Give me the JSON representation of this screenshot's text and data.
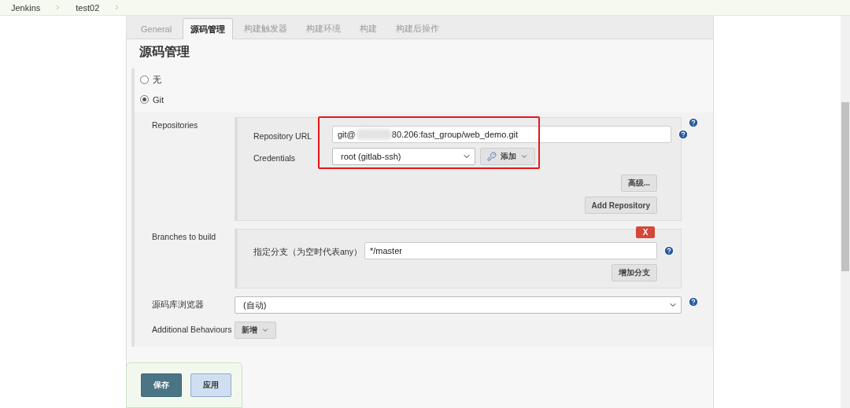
{
  "breadcrumbs": [
    "Jenkins",
    "test02"
  ],
  "tabs": [
    {
      "label": "General",
      "selected": false
    },
    {
      "label": "源码管理",
      "selected": true
    },
    {
      "label": "构建触发器",
      "selected": false
    },
    {
      "label": "构建环境",
      "selected": false
    },
    {
      "label": "构建",
      "selected": false
    },
    {
      "label": "构建后操作",
      "selected": false
    }
  ],
  "heading": "源码管理",
  "scm_options": [
    {
      "label": "无",
      "selected": false
    },
    {
      "label": "Git",
      "selected": true
    }
  ],
  "repositories": {
    "label": "Repositories",
    "url_label": "Repository URL",
    "url_prefix": "git@",
    "url_suffix": "80.206:fast_group/web_demo.git",
    "credentials_label": "Credentials",
    "credentials_value": "root (gitlab-ssh)",
    "add_button": "添加",
    "advanced_button": "高级...",
    "add_repository_button": "Add Repository"
  },
  "branches": {
    "label": "Branches to build",
    "delete_button": "X",
    "branch_label": "指定分支（为空时代表any）",
    "branch_value": "*/master",
    "add_branch_button": "增加分支"
  },
  "browser": {
    "label": "源码库浏览器",
    "value": "(自动)"
  },
  "behaviours": {
    "label": "Additional Behaviours",
    "button": "新增"
  },
  "footer_buttons": [
    {
      "label": "保存",
      "kind": "primary"
    },
    {
      "label": "应用",
      "kind": "secondary"
    }
  ]
}
